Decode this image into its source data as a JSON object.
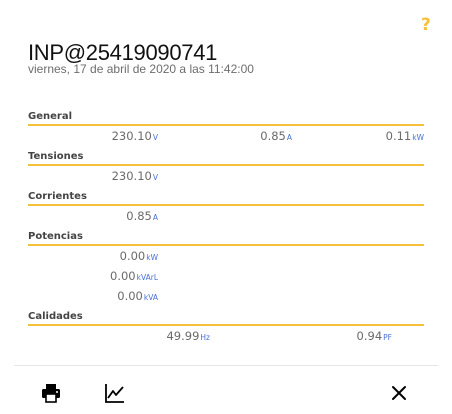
{
  "help_label": "?",
  "device": {
    "id": "INP@25419090741",
    "date": "viernes, 17 de abril de 2020 a las 11:42:00"
  },
  "sections": {
    "general": {
      "title": "General",
      "v1": "230.10",
      "u1": "V",
      "v2": "0.85",
      "u2": "A",
      "v3": "0.11",
      "u3": "kW"
    },
    "tensiones": {
      "title": "Tensiones",
      "v1": "230.10",
      "u1": "V"
    },
    "corrientes": {
      "title": "Corrientes",
      "v1": "0.85",
      "u1": "A"
    },
    "potencias": {
      "title": "Potencias",
      "rows": [
        {
          "value": "0.00",
          "unit": "kW"
        },
        {
          "value": "0.00",
          "unit": "kVArL"
        },
        {
          "value": "0.00",
          "unit": "kVA"
        }
      ]
    },
    "calidades": {
      "title": "Calidades",
      "v1": "49.99",
      "u1": "Hz",
      "v2": "0.94",
      "u2": "PF"
    }
  },
  "footer": {
    "print_icon": "print-icon",
    "chart_icon": "line-chart-icon",
    "close_icon": "close-icon"
  },
  "colors": {
    "accent": "#f5c13d",
    "unit": "#4a6fd6"
  }
}
